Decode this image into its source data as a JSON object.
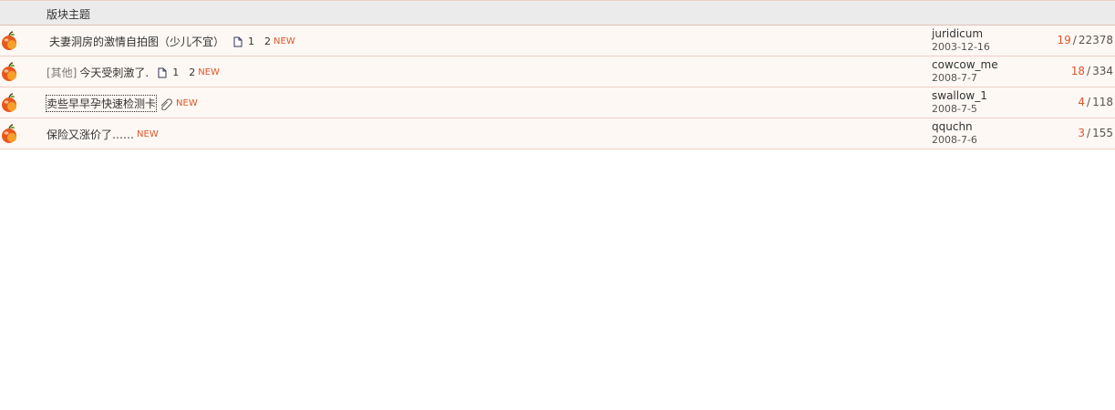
{
  "header": {
    "column_title": "版块主题"
  },
  "threads": [
    {
      "type_label": "",
      "title": "夫妻洞房的激情自拍图（少儿不宜）",
      "pages": [
        "1",
        "2"
      ],
      "new_label": "NEW",
      "author": "juridicum",
      "date": "2003-12-16",
      "replies": "19",
      "views": "22378",
      "sep": "/"
    },
    {
      "type_label": "[其他]",
      "title": "今天受刺激了.",
      "pages": [
        "1",
        "2"
      ],
      "new_label": "NEW",
      "author": "cowcow_me",
      "date": "2008-7-7",
      "replies": "18",
      "views": "334",
      "sep": "/"
    },
    {
      "type_label": "",
      "title": "卖些早早孕快速检测卡",
      "pages": [],
      "new_label": "NEW",
      "author": "swallow_1",
      "date": "2008-7-5",
      "replies": "4",
      "views": "118",
      "sep": "/"
    },
    {
      "type_label": "",
      "title": "保险又涨价了……",
      "pages": [],
      "new_label": "NEW",
      "author": "qquchn",
      "date": "2008-7-6",
      "replies": "3",
      "views": "155",
      "sep": "/"
    }
  ],
  "colors": {
    "header_bg": "#ebebeb",
    "row_bg": "#fdf8f4",
    "accent": "#e0552a",
    "border": "#f0cfc2"
  },
  "icons": {
    "thread_status": "apple-folder-icon",
    "multipage": "page-icon",
    "attachment": "paperclip-icon"
  }
}
